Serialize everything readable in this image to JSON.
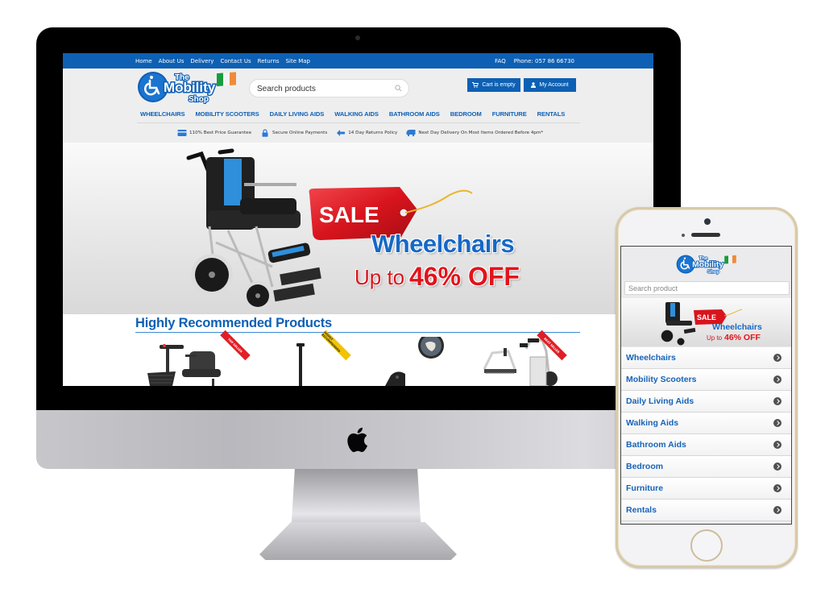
{
  "desktop_site": {
    "topbar": {
      "links": [
        "Home",
        "About Us",
        "Delivery",
        "Contact Us",
        "Returns",
        "Site Map"
      ],
      "faq": "FAQ",
      "phone": "Phone: 057 86 66730",
      "color": "#0d60b4"
    },
    "header": {
      "logo": {
        "line1": "The",
        "line2": "Mobility",
        "line3": "Shop"
      },
      "search_placeholder": "Search products",
      "cart_label": "Cart is empty",
      "account_label": "My Account"
    },
    "nav": [
      "WHEELCHAIRS",
      "MOBILITY SCOOTERS",
      "DAILY LIVING AIDS",
      "WALKING AIDS",
      "BATHROOM AIDS",
      "BEDROOM",
      "FURNITURE",
      "RENTALS"
    ],
    "usps": [
      {
        "icon": "credit-card-icon",
        "text": "110% Best Price Guarantee"
      },
      {
        "icon": "lock-icon",
        "text": "Secure Online Payments"
      },
      {
        "icon": "arrow-left-icon",
        "text": "14 Day Returns Policy"
      },
      {
        "icon": "truck-icon",
        "text": "Next Day Delivery On Most Items Ordered Before 4pm*"
      }
    ],
    "hero": {
      "tag": "SALE",
      "title": "Wheelchairs",
      "upto": "Up to",
      "discount": "46% OFF"
    },
    "recommended": {
      "title": "Highly Recommended Products",
      "products": [
        {
          "name": "mobility-scooter",
          "badge": "TOP SELLER",
          "badge_color": "#e01f26"
        },
        {
          "name": "walking-stick",
          "badge": "HIGHLY RECOMMENDED",
          "badge_color": "#f2c300"
        },
        {
          "name": "riser-recliner-chair",
          "badge": "",
          "badge_color": ""
        },
        {
          "name": "rollator",
          "badge": "BEST SELLER",
          "badge_color": "#e01f26"
        }
      ]
    }
  },
  "mobile_site": {
    "logo": {
      "line1": "The",
      "line2": "Mobility",
      "line3": "Shop"
    },
    "search_placeholder": "Search product",
    "hero": {
      "tag": "SALE",
      "title": "Wheelchairs",
      "upto": "Up to",
      "discount": "46% OFF"
    },
    "menu": [
      "Wheelchairs",
      "Mobility Scooters",
      "Daily Living Aids",
      "Walking Aids",
      "Bathroom Aids",
      "Bedroom",
      "Furniture",
      "Rentals"
    ]
  }
}
